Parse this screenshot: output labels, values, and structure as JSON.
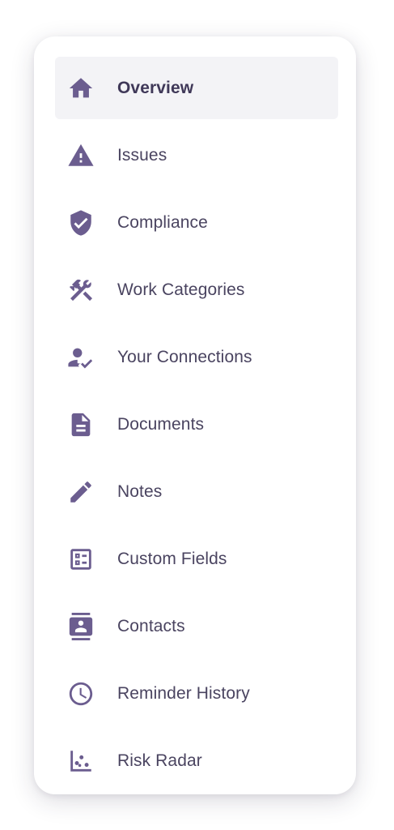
{
  "nav": {
    "items": [
      {
        "label": "Overview",
        "icon": "home-icon",
        "active": true
      },
      {
        "label": "Issues",
        "icon": "warning-icon",
        "active": false
      },
      {
        "label": "Compliance",
        "icon": "shield-check-icon",
        "active": false
      },
      {
        "label": "Work Categories",
        "icon": "tools-icon",
        "active": false
      },
      {
        "label": "Your Connections",
        "icon": "user-check-icon",
        "active": false
      },
      {
        "label": "Documents",
        "icon": "document-icon",
        "active": false
      },
      {
        "label": "Notes",
        "icon": "pencil-icon",
        "active": false
      },
      {
        "label": "Custom Fields",
        "icon": "form-fields-icon",
        "active": false
      },
      {
        "label": "Contacts",
        "icon": "contact-book-icon",
        "active": false
      },
      {
        "label": "Reminder History",
        "icon": "clock-icon",
        "active": false
      },
      {
        "label": "Risk Radar",
        "icon": "scatter-chart-icon",
        "active": false
      }
    ]
  },
  "colors": {
    "icon": "#6b5d8f",
    "active_bg": "#f3f3f6",
    "text": "#4a4460"
  }
}
